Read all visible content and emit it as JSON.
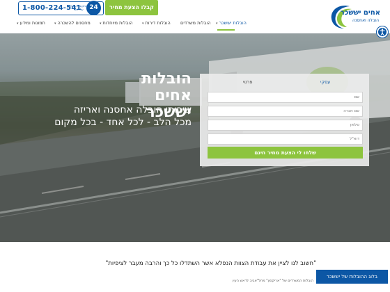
{
  "header": {
    "phone": "1-800-224-541",
    "phone_hours": "התקשרו עכשיו על היום",
    "badge": "24",
    "quote_button": "קבלו הצעת מחיר"
  },
  "logo": {
    "title": "אחים יששכר",
    "subtitle": "הובלה ואחסנה"
  },
  "nav": {
    "items": [
      {
        "label": "הובלות יששכר",
        "caret": true
      },
      {
        "label": "הובלות משרדים",
        "caret": false
      },
      {
        "label": "הובלות דירות",
        "caret": true
      },
      {
        "label": "הובלות מיוחדות",
        "caret": true
      },
      {
        "label": "מחסנים להשכרה",
        "caret": true
      },
      {
        "label": "תמונות ומידע",
        "caret": true
      }
    ],
    "caret_glyph": "▾"
  },
  "hero": {
    "title": "הובלות אחים יששכר",
    "subtitle_line1": "שירותי הובלה אחסנה ואריזה",
    "subtitle_line2": "מכל הלב - לכל אחד - בכל מקום"
  },
  "form": {
    "tab_business": "עסקי",
    "tab_private": "פרטי",
    "fields": [
      {
        "placeholder": "שם"
      },
      {
        "placeholder": "שם חברה"
      },
      {
        "placeholder": "טלפון"
      },
      {
        "placeholder": "דוא\"ל"
      }
    ],
    "submit": "שלחו לי הצעת מחיר חינם"
  },
  "bottom": {
    "quote": "\"חשוב לנו לציין את עבודת הצוות הנפלא אשר השתדלו כל כך והרבה מעבר לציפיות\"",
    "author": "הובלות המשרדים של \"אריקסון\" מחל\"אביב לראש העין",
    "blog_button": "בלוג ההובלות של יששכר"
  },
  "colors": {
    "brand_blue": "#0c57a5",
    "accent_green": "#8dc43e"
  },
  "icons": {
    "logo": "swoosh-logo-icon",
    "accessibility": "accessibility-icon",
    "clock": "clock-24-icon"
  }
}
